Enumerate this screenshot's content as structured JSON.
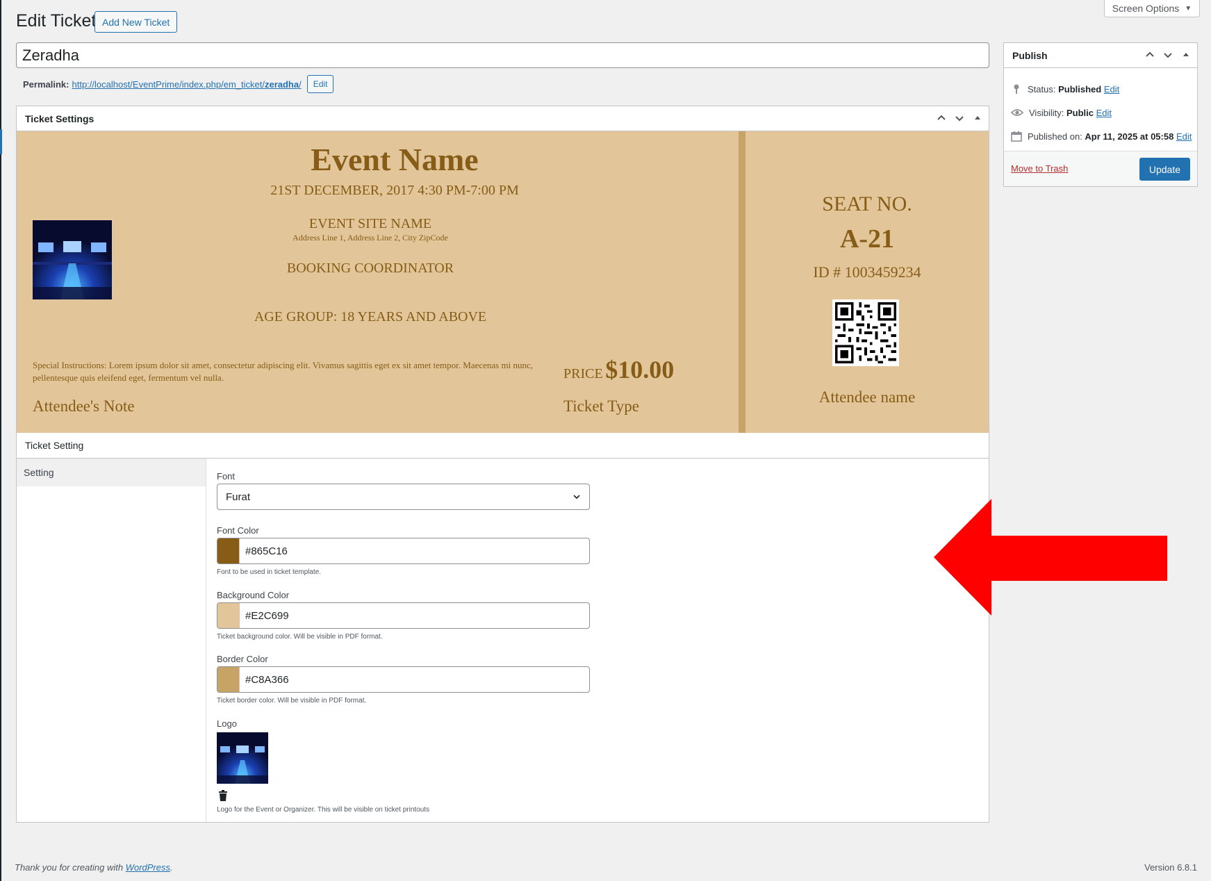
{
  "header": {
    "title": "Edit Ticket",
    "add_new_label": "Add New Ticket",
    "screen_options_label": "Screen Options"
  },
  "post": {
    "title_value": "Zeradha",
    "permalink_label": "Permalink:",
    "permalink_base": "http://localhost/EventPrime/index.php/em_ticket/",
    "permalink_slug": "zeradha",
    "permalink_suffix": "/",
    "edit_label": "Edit"
  },
  "ticket_box": {
    "title": "Ticket Settings",
    "preview": {
      "event_name": "Event Name",
      "date_time": "21ST DECEMBER, 2017 4:30 PM-7:00 PM",
      "site_name": "EVENT SITE NAME",
      "address": "Address Line 1, Address Line 2, City ZipCode",
      "coordinator": "BOOKING COORDINATOR",
      "age_group": "AGE GROUP: 18 YEARS AND ABOVE",
      "instructions_line1": "Special Instructions: Lorem ipsum dolor sit amet, consectetur adipiscing elit. Vivamus sagittis eget ex sit amet tempor. Maecenas mi nunc,",
      "instructions_line2": "pellentesque quis eleifend eget, fermentum vel nulla.",
      "attendee_note": "Attendee's Note",
      "price_label": "PRICE",
      "price_value": "$10.00",
      "ticket_type": "Ticket Type",
      "seat_label": "SEAT NO.",
      "seat_value": "A-21",
      "id_text": "ID # 1003459234",
      "attendee_name": "Attendee name"
    },
    "settings": {
      "title": "Ticket Setting",
      "sidebar_item": "Setting",
      "font_label": "Font",
      "font_value": "Furat",
      "font_color_label": "Font Color",
      "font_color_value": "#865C16",
      "font_color_help": "Font to be used in ticket template.",
      "bg_color_label": "Background Color",
      "bg_color_value": "#E2C699",
      "bg_color_help": "Ticket background color. Will be visible in PDF format.",
      "border_color_label": "Border Color",
      "border_color_value": "#C8A366",
      "border_color_help": "Ticket border color. Will be visible in PDF format.",
      "logo_label": "Logo",
      "logo_help": "Logo for the Event or Organizer. This will be visible on ticket printouts"
    }
  },
  "publish": {
    "title": "Publish",
    "status_label": "Status:",
    "status_value": "Published",
    "visibility_label": "Visibility:",
    "visibility_value": "Public",
    "published_label": "Published on:",
    "published_value": "Apr 11, 2025 at 05:58",
    "edit_label": "Edit",
    "trash_label": "Move to Trash",
    "update_label": "Update"
  },
  "footer": {
    "thanks_prefix": "Thank you for creating with ",
    "wp_link": "WordPress",
    "thanks_suffix": ".",
    "version": "Version 6.8.1"
  },
  "colors": {
    "accent": "#2271b1",
    "ticket_font": "#865C16",
    "ticket_bg": "#E2C699",
    "ticket_border": "#C8A366",
    "annotation_arrow": "#ff0000"
  }
}
